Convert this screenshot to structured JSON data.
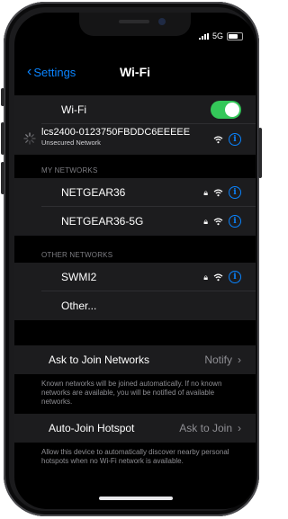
{
  "status": {
    "network": "5G"
  },
  "nav": {
    "back_label": "Settings",
    "title": "Wi-Fi"
  },
  "wifi": {
    "label": "Wi-Fi",
    "toggle_on": true,
    "connecting_network": "lcs2400-0123750FBDDC6EEEEE",
    "connecting_subtitle": "Unsecured Network"
  },
  "my_networks": {
    "header": "MY NETWORKS",
    "items": [
      {
        "name": "NETGEAR36"
      },
      {
        "name": "NETGEAR36-5G"
      }
    ]
  },
  "other_networks": {
    "header": "OTHER NETWORKS",
    "items": [
      {
        "name": "SWMI2"
      }
    ],
    "other_label": "Other..."
  },
  "ask_to_join": {
    "label": "Ask to Join Networks",
    "value": "Notify",
    "note": "Known networks will be joined automatically. If no known networks are available, you will be notified of available networks."
  },
  "auto_join": {
    "label": "Auto-Join Hotspot",
    "value": "Ask to Join",
    "note": "Allow this device to automatically discover nearby personal hotspots when no Wi-Fi network is available."
  },
  "colors": {
    "accent": "#0a84ff",
    "toggle_on": "#34c759",
    "background": "#000000",
    "group_bg": "#1c1c1e"
  }
}
